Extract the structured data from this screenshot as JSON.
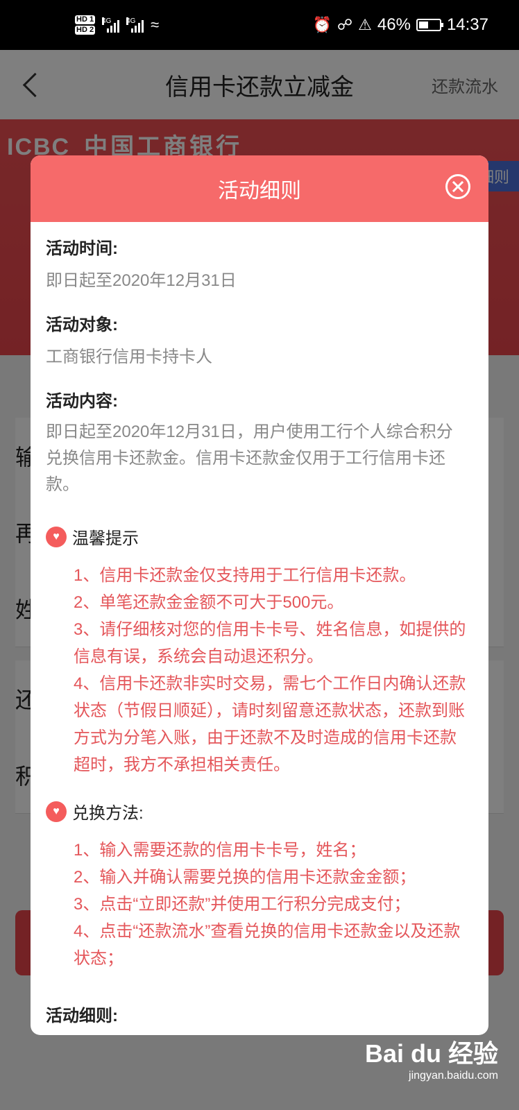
{
  "status_bar": {
    "hd1": "HD 1",
    "hd2": "HD 2",
    "net1": "4G",
    "net2": "4G",
    "battery_pct": "46%",
    "battery_level": 0.46,
    "time": "14:37",
    "icons": [
      "alarm-icon",
      "headphones-icon",
      "mute-icon",
      "battery-icon",
      "wifi-icon"
    ]
  },
  "app_bar": {
    "title": "信用卡还款立减金",
    "right_link": "还款流水"
  },
  "banner": {
    "logo_text": "ICBC",
    "bank_name": "中国工商银行",
    "tag": "细则"
  },
  "form": {
    "row1": "输",
    "row2": "再",
    "row3": "姓",
    "row4": "还",
    "row5": "积"
  },
  "modal": {
    "title": "活动细则",
    "time_label": "活动时间:",
    "time_value": "即日起至2020年12月31日",
    "target_label": "活动对象:",
    "target_value": "工商银行信用卡持卡人",
    "content_label": "活动内容:",
    "content_value": "即日起至2020年12月31日，用户使用工行个人综合积分兑换信用卡还款金。信用卡还款金仅用于工行信用卡还款。",
    "tips_label": "温馨提示",
    "tips": [
      "1、信用卡还款金仅支持用于工行信用卡还款。",
      "2、单笔还款金金额不可大于500元。",
      "3、请仔细核对您的信用卡卡号、姓名信息，如提供的信息有误，系统会自动退还积分。",
      "4、信用卡还款非实时交易，需七个工作日内确认还款状态（节假日顺延），请时刻留意还款状态，还款到账方式为分笔入账，由于还款不及时造成的信用卡还款超时，我方不承担相关责任。"
    ],
    "method_label": "兑换方法:",
    "methods": [
      "1、输入需要还款的信用卡卡号，姓名；",
      "2、输入并确认需要兑换的信用卡还款金金额；",
      "3、点击“立即还款”并使用工行积分完成支付；",
      "4、点击“还款流水”查看兑换的信用卡还款金以及还款状态；"
    ],
    "details_label": "活动细则:"
  },
  "watermark": {
    "main": "Bai du 经验",
    "sub": "jingyan.baidu.com"
  }
}
